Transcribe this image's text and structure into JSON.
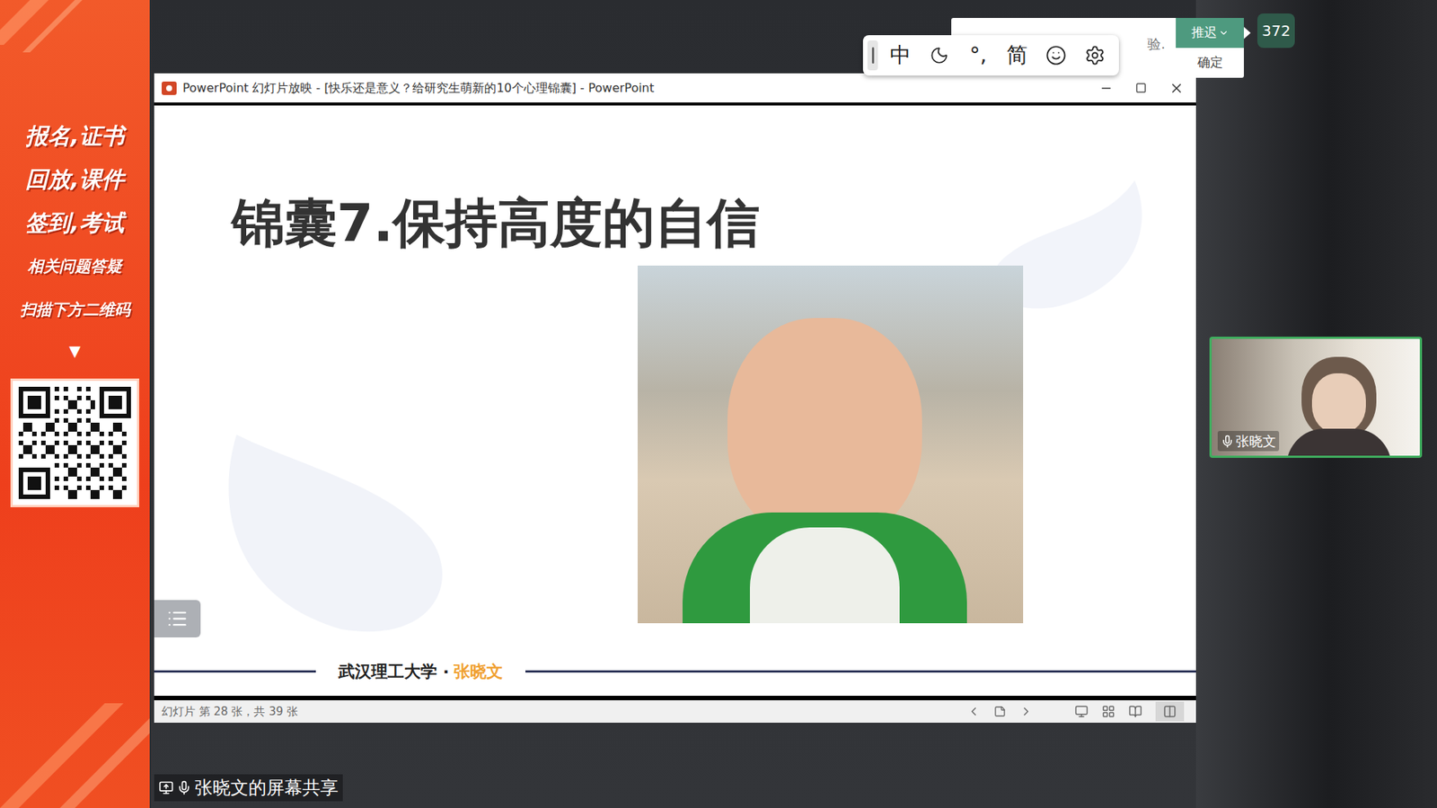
{
  "sidebar_banner": {
    "lines": [
      {
        "text": "报名,证书",
        "kind": "large"
      },
      {
        "text": "回放,课件",
        "kind": "large"
      },
      {
        "text": "签到,考试",
        "kind": "large"
      },
      {
        "text": "相关问题答疑",
        "kind": "small"
      },
      {
        "text": "扫描下方二维码",
        "kind": "small"
      }
    ],
    "arrow": "▼"
  },
  "window": {
    "title": "PowerPoint 幻灯片放映 - [快乐还是意义？给研究生萌新的10个心理锦囊] - PowerPoint"
  },
  "slide": {
    "title": "锦囊7.保持高度的自信",
    "footer_org": "武汉理工大学 ·",
    "footer_name": "张晓文"
  },
  "status_bar": {
    "text": "幻灯片 第 28 张，共 39 张"
  },
  "ime_toolbar": {
    "items": [
      {
        "kind": "text",
        "label": "中"
      },
      {
        "kind": "moon",
        "label": ""
      },
      {
        "kind": "text",
        "label": "°,"
      },
      {
        "kind": "text",
        "label": "简"
      },
      {
        "kind": "smiley",
        "label": ""
      },
      {
        "kind": "gear",
        "label": ""
      }
    ]
  },
  "notification": {
    "text_fragment": "验.",
    "snooze": "推迟",
    "confirm": "确定"
  },
  "participant_count": "372",
  "video_tile": {
    "name": "张晓文",
    "mic_on": true
  },
  "screen_share_label": "张晓文的屏幕共享"
}
